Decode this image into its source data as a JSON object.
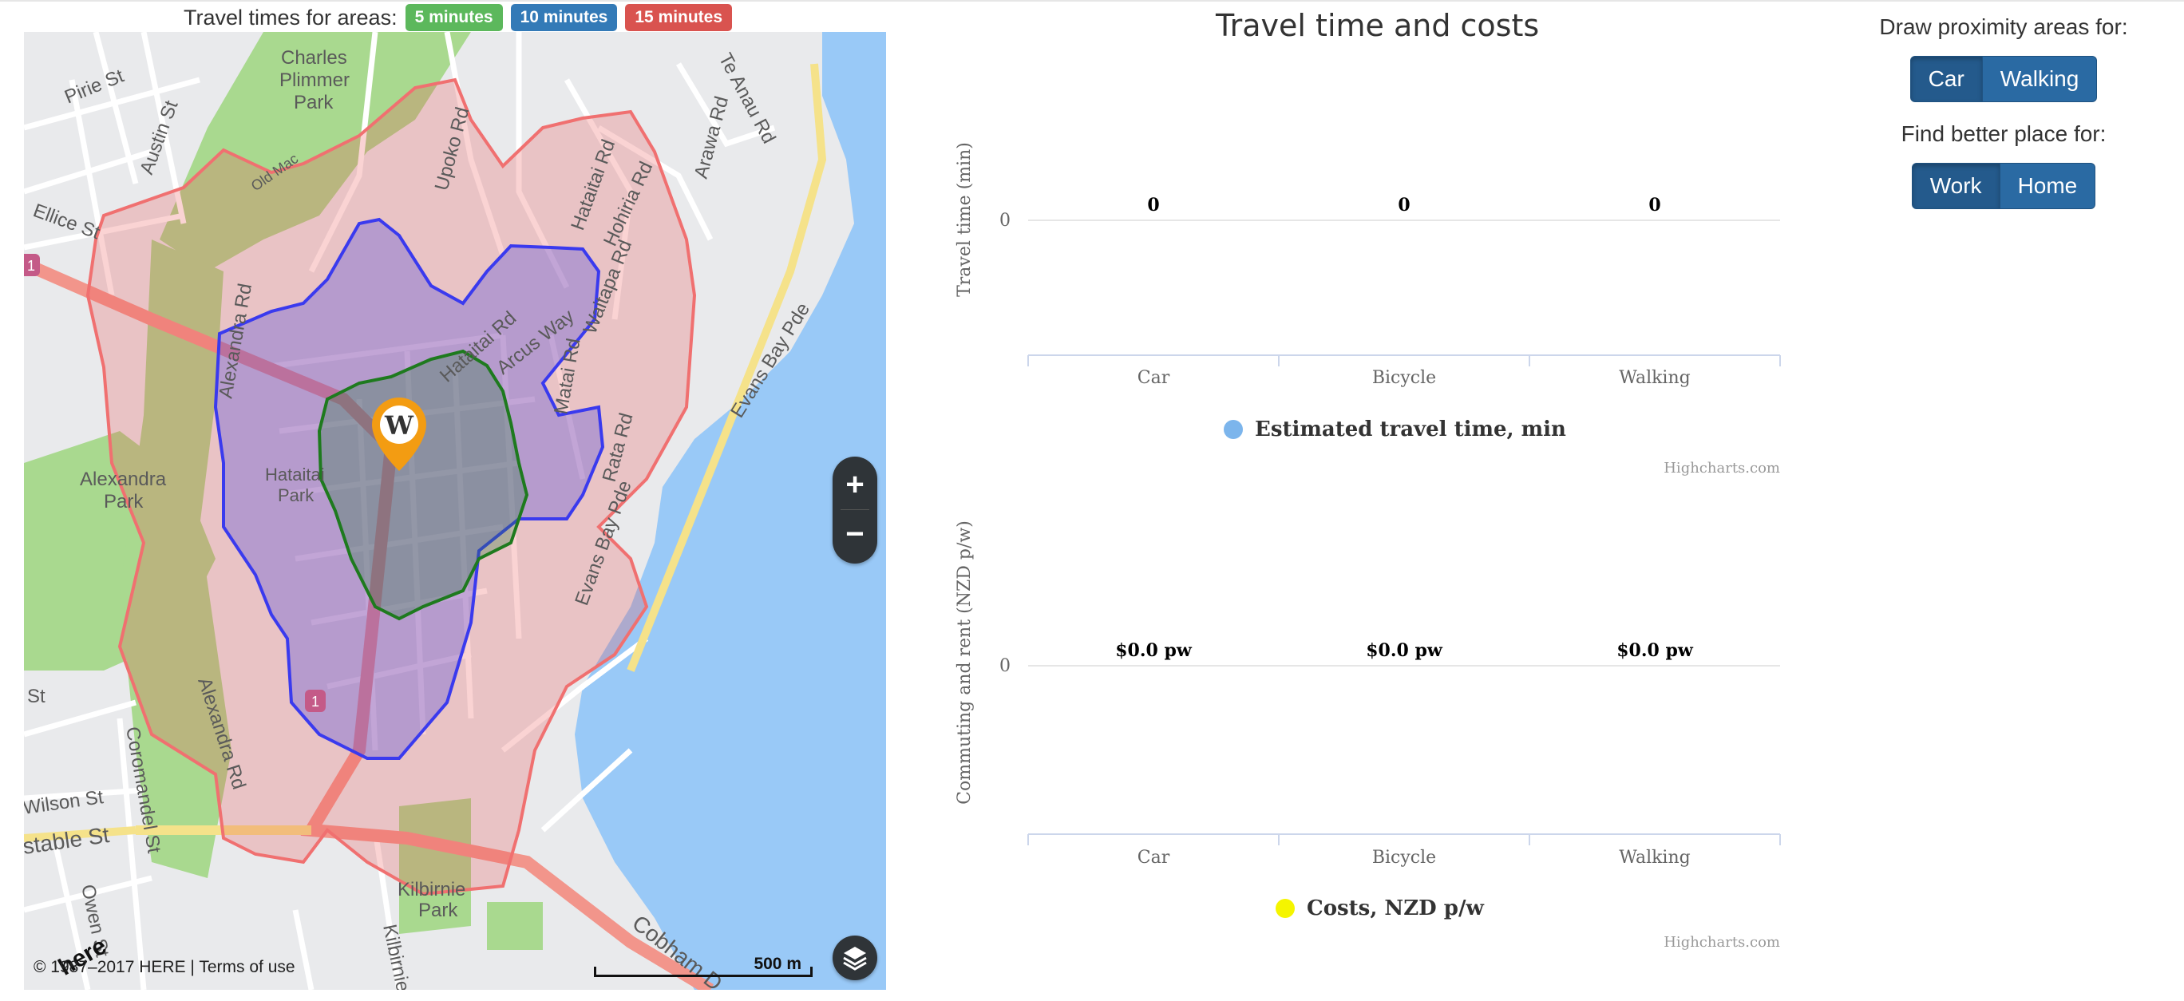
{
  "legend": {
    "title": "Travel times for areas:",
    "badges": [
      {
        "label": "5 minutes",
        "color": "#5cb85c"
      },
      {
        "label": "10 minutes",
        "color": "#337ab7"
      },
      {
        "label": "15 minutes",
        "color": "#d9534f"
      }
    ]
  },
  "map": {
    "marker_letter": "W",
    "street_labels": {
      "pirie": "Pirie St",
      "austin": "Austin St",
      "ellice": "Ellice St",
      "charles": "Charles",
      "plimmer": "Plimmer",
      "park1": "Park",
      "oldmac": "Old Mac",
      "upoko": "Upoko Rd",
      "hataitai_rd": "Hataitai Rd",
      "hohiria": "Hohiria Rd",
      "arawa": "Arawa Rd",
      "teanau": "Te Anau Rd",
      "alexandra_rd": "Alexandra Rd",
      "hataitai_rd2": "Hataitai Rd",
      "arcus": "Arcus Way",
      "waitapa": "Waitapa Rd",
      "evans1": "Evans Bay Pde",
      "matai": "Matai Rd",
      "rata": "Rata Rd",
      "alexandra_park": "Alexandra",
      "park2": "Park",
      "hataitai_park": "Hataitai",
      "park3": "Park",
      "evans2": "Evans Bay Pde",
      "alexandra_rd2": "Alexandra Rd",
      "coromandel": "Coromandel St",
      "wilson": "Wilson St",
      "constable": "stable St",
      "st": "St",
      "owen": "Owen St",
      "kilbirnie": "Kilbirnie",
      "park4": "Park",
      "kilbirnie_cres": "Kilbirnie Cres",
      "cobham": "Cobham D",
      "route_1a": "1",
      "route_1b": "1"
    },
    "zoom_in": "+",
    "zoom_out": "−",
    "here_logo": "here",
    "copyright": "© 1987–2017 HERE | Terms of use",
    "scale": "500 m"
  },
  "charts": {
    "title": "Travel time and costs",
    "travel": {
      "ylabel": "Travel time (min)",
      "ytick": "0",
      "legend": "Estimated travel time, min",
      "legend_color": "#7cb5ec",
      "credits": "Highcharts.com"
    },
    "costs": {
      "ylabel": "Commuting and rent (NZD p/w)",
      "ytick": "0",
      "legend": "Costs, NZD p/w",
      "legend_color": "#f5f500",
      "credits": "Highcharts.com"
    }
  },
  "chart_data": [
    {
      "type": "bar",
      "categories": [
        "Car",
        "Bicycle",
        "Walking"
      ],
      "series": [
        {
          "name": "Estimated travel time, min",
          "values": [
            0,
            0,
            0
          ],
          "labels": [
            "0",
            "0",
            "0"
          ]
        }
      ],
      "ylabel": "Travel time (min)"
    },
    {
      "type": "bar",
      "categories": [
        "Car",
        "Bicycle",
        "Walking"
      ],
      "series": [
        {
          "name": "Costs, NZD p/w",
          "values": [
            0.0,
            0.0,
            0.0
          ],
          "labels": [
            "$0.0 pw",
            "$0.0 pw",
            "$0.0 pw"
          ]
        }
      ],
      "ylabel": "Commuting and rent (NZD p/w)"
    }
  ],
  "sidebar": {
    "proximity_label": "Draw proximity areas for:",
    "proximity_buttons": [
      "Car",
      "Walking"
    ],
    "better_label": "Find better place for:",
    "better_buttons": [
      "Work",
      "Home"
    ]
  }
}
